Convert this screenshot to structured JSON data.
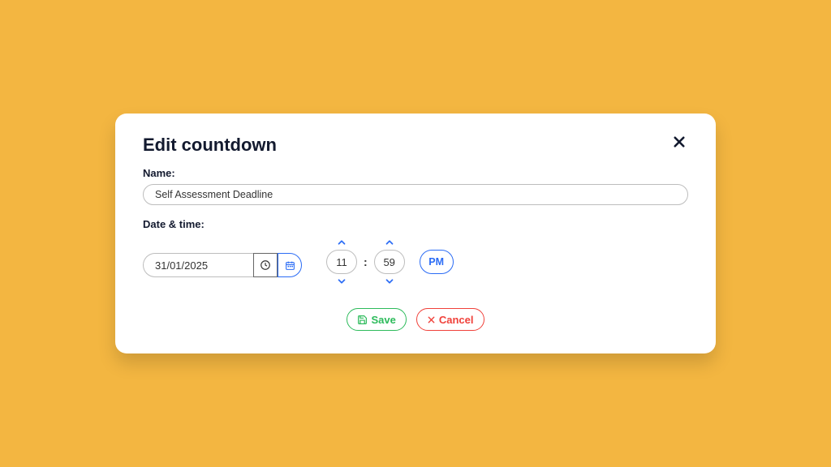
{
  "dialog": {
    "title": "Edit countdown",
    "name_label": "Name:",
    "name_value": "Self Assessment Deadline",
    "datetime_label": "Date & time:",
    "date_value": "31/01/2025",
    "hour_value": "11",
    "minute_value": "59",
    "ampm": "PM",
    "time_separator": ":",
    "save_label": "Save",
    "cancel_label": "Cancel"
  }
}
